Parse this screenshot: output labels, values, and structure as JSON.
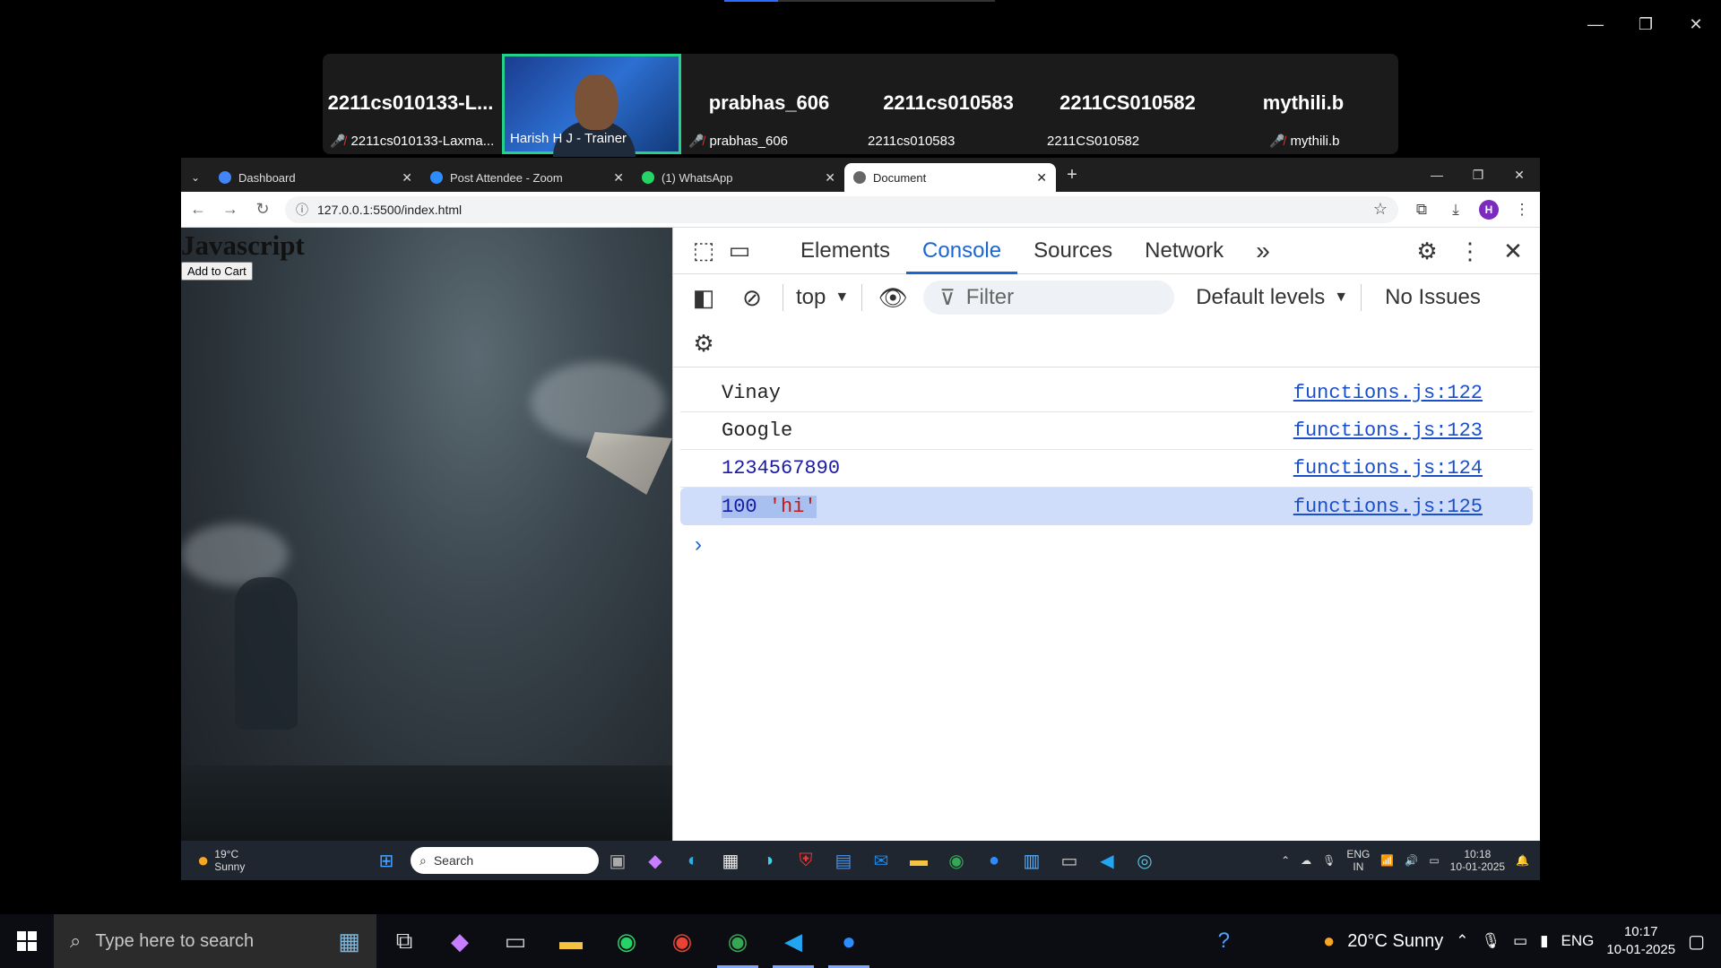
{
  "zoom_window": {
    "controls": [
      "—",
      "❐",
      "✕"
    ]
  },
  "participants": [
    {
      "name": "2211cs010133-L...",
      "label": "2211cs010133-Laxma...",
      "muted": true
    },
    {
      "name": "",
      "label": "Harish H J - Trainer",
      "muted": false,
      "video": true
    },
    {
      "name": "prabhas_606",
      "label": "prabhas_606",
      "muted": true
    },
    {
      "name": "2211cs010583",
      "label": "2211cs010583",
      "muted": false
    },
    {
      "name": "2211CS010582",
      "label": "2211CS010582",
      "muted": false
    },
    {
      "name": "mythili.b",
      "label": "mythili.b",
      "muted": true
    }
  ],
  "browser": {
    "tabs": [
      {
        "title": "Dashboard",
        "icon_color": "#4285f4"
      },
      {
        "title": "Post Attendee - Zoom",
        "icon_color": "#2d8cff"
      },
      {
        "title": "(1) WhatsApp",
        "icon_color": "#25d366"
      },
      {
        "title": "Document",
        "icon_color": "#666666",
        "active": true
      }
    ],
    "url": "127.0.0.1:5500/index.html",
    "profile_initial": "H"
  },
  "page": {
    "title": "Javascript",
    "button_label": "Add to Cart"
  },
  "devtools": {
    "tabs": [
      "Elements",
      "Console",
      "Sources",
      "Network"
    ],
    "active_tab": "Console",
    "more_tabs": "»",
    "context": "top",
    "filter_placeholder": "Filter",
    "levels": "Default levels",
    "issues": "No Issues",
    "console": [
      {
        "parts": [
          {
            "text": "Vinay",
            "type": "plain"
          }
        ],
        "source": "functions.js:122",
        "selected": false
      },
      {
        "parts": [
          {
            "text": "Google",
            "type": "plain"
          }
        ],
        "source": "functions.js:123",
        "selected": false
      },
      {
        "parts": [
          {
            "text": "1234567890",
            "type": "num"
          }
        ],
        "source": "functions.js:124",
        "selected": false
      },
      {
        "parts": [
          {
            "text": "100 ",
            "type": "num"
          },
          {
            "text": "'hi'",
            "type": "str"
          }
        ],
        "source": "functions.js:125",
        "selected": true
      }
    ],
    "prompt": "›"
  },
  "inner_taskbar": {
    "weather_temp": "19°C",
    "weather_desc": "Sunny",
    "search_label": "Search",
    "lang": "ENG",
    "region": "IN",
    "time": "10:18",
    "date": "10-01-2025"
  },
  "taskbar": {
    "search_placeholder": "Type here to search",
    "weather": "20°C  Sunny",
    "lang": "ENG",
    "time": "10:17",
    "date": "10-01-2025"
  }
}
